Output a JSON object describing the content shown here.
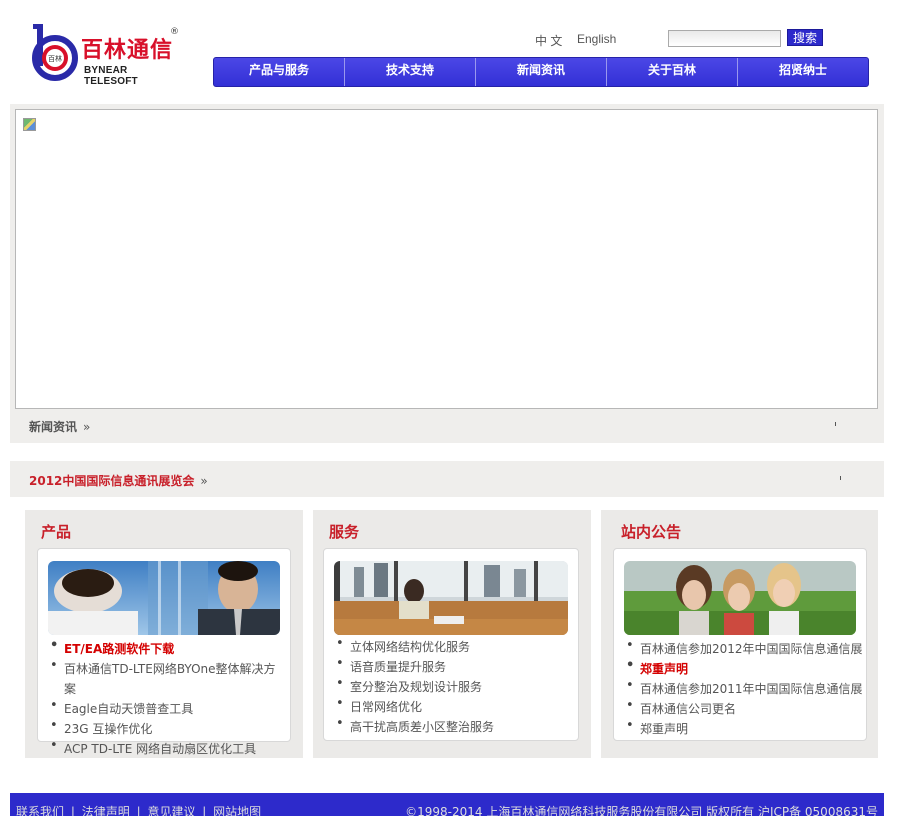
{
  "header": {
    "logo_cn": "百林通信",
    "logo_en": "BYNEAR TELESOFT",
    "logo_reg": "®",
    "lang_cn": "中 文",
    "lang_en": "English",
    "search_placeholder": "",
    "search_button": "搜索"
  },
  "nav": {
    "items": [
      {
        "label": "产品与服务"
      },
      {
        "label": "技术支持"
      },
      {
        "label": "新闻资讯"
      },
      {
        "label": "关于百林"
      },
      {
        "label": "招贤纳士"
      }
    ]
  },
  "banner": {
    "news_label": "新闻资讯",
    "raquo": "»",
    "expo_label": "2012中国国际信息通讯展览会"
  },
  "products": {
    "title": "产品",
    "items": [
      "ET/EA路测软件下载",
      "百林通信TD-LTE网络BYOne整体解决方案",
      "Eagle自动天馈普查工具",
      "23G 互操作优化",
      "ACP TD-LTE 网络自动扇区优化工具"
    ]
  },
  "services": {
    "title": "服务",
    "items": [
      "立体网络结构优化服务",
      "语音质量提升服务",
      "室分整治及规划设计服务",
      "日常网络优化",
      "高干扰高质差小区整治服务"
    ]
  },
  "notices": {
    "title": "站内公告",
    "items": [
      "百林通信参加2012年中国国际信息通信展",
      "郑重声明",
      "百林通信参加2011年中国国际信息通信展",
      "百林通信公司更名",
      "郑重声明"
    ]
  },
  "footer": {
    "links": [
      "联系我们",
      "法律声明",
      "意见建议",
      "网站地图"
    ],
    "separator": "|",
    "copyright": "©1998-2014 上海百林通信网络科技服务股份有限公司  版权所有  沪ICP备 05008631号"
  },
  "colors": {
    "nav_blue": "#3330d6",
    "accent_red": "#c8202a",
    "footer_blue": "#2d2acb"
  }
}
